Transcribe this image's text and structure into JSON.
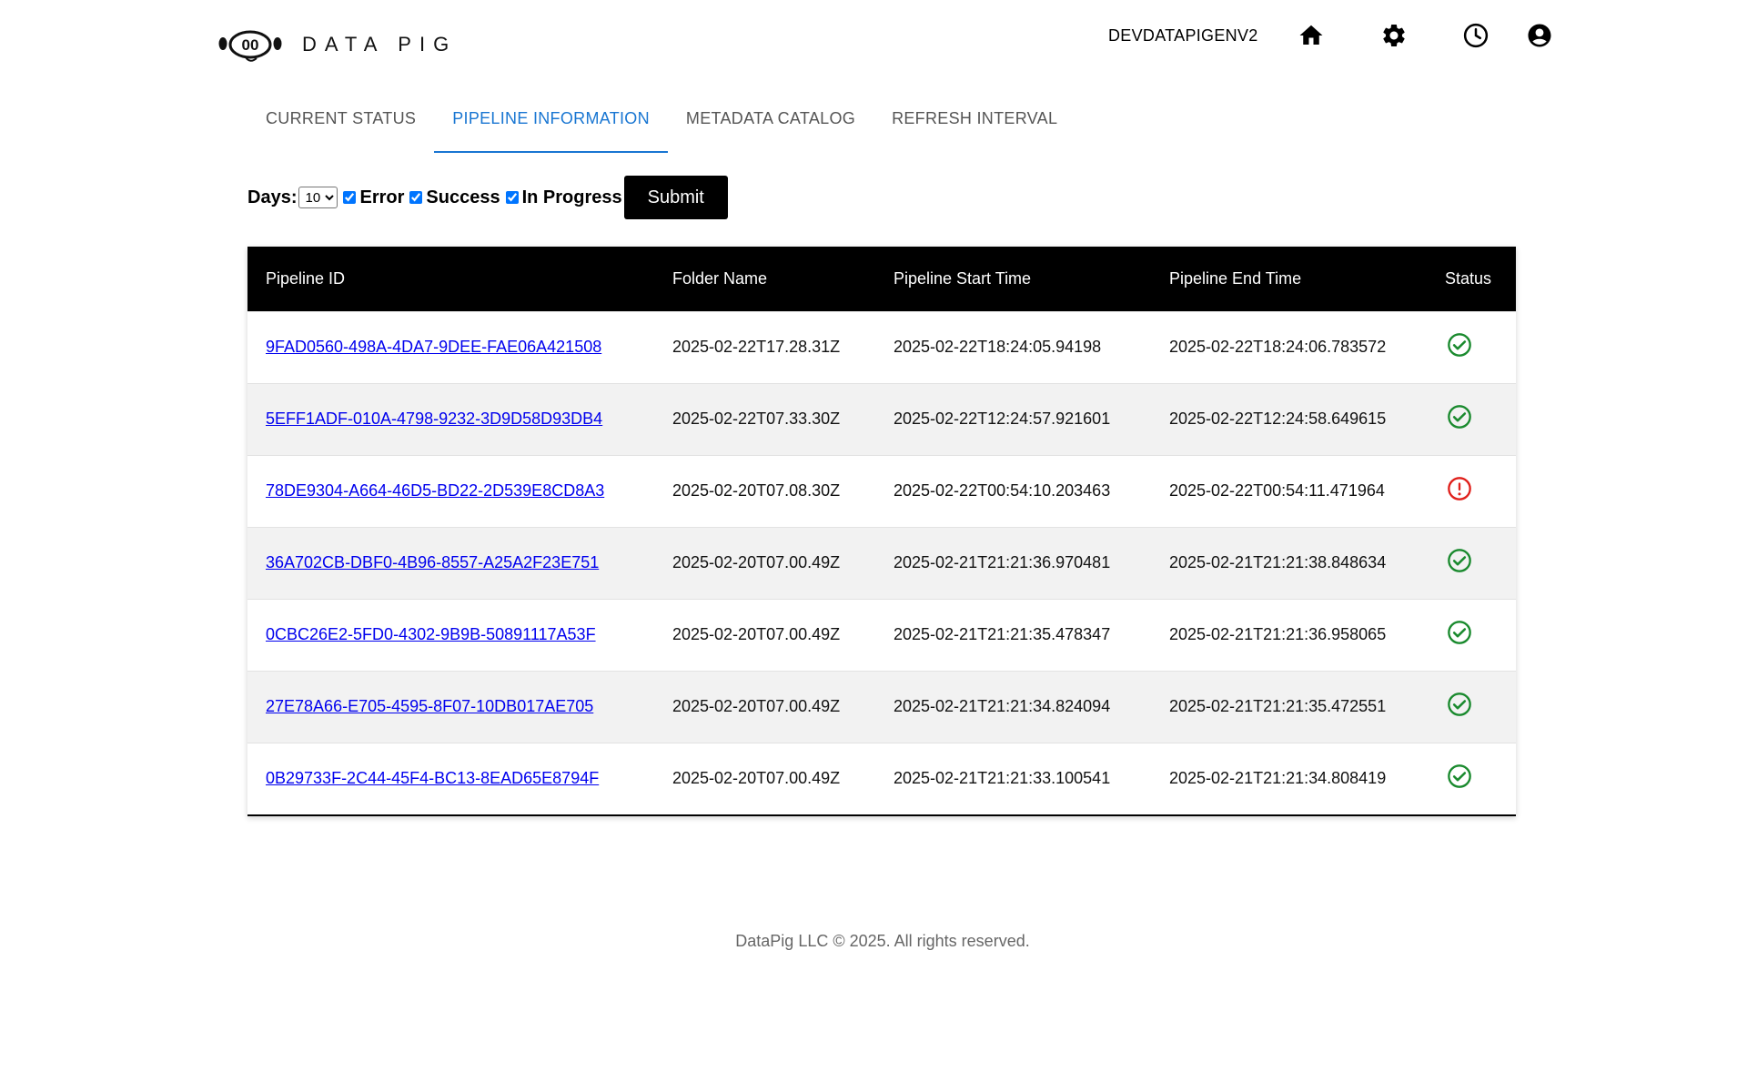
{
  "brand": {
    "name": "DATA PIG"
  },
  "header": {
    "environment": "DEVDATAPIGENV2",
    "icons": [
      "home-icon",
      "gear-icon",
      "clock-icon",
      "account-icon"
    ]
  },
  "tabs": [
    {
      "label": "CURRENT STATUS",
      "active": false
    },
    {
      "label": "PIPELINE INFORMATION",
      "active": true
    },
    {
      "label": "METADATA CATALOG",
      "active": false
    },
    {
      "label": "REFRESH INTERVAL",
      "active": false
    }
  ],
  "filters": {
    "days_label": "Days:",
    "days_value": "10",
    "error_label": "Error",
    "error_checked": true,
    "success_label": "Success",
    "success_checked": true,
    "in_progress_label": "In Progress",
    "in_progress_checked": true,
    "submit_label": "Submit"
  },
  "table": {
    "columns": [
      "Pipeline ID",
      "Folder Name",
      "Pipeline Start Time",
      "Pipeline End Time",
      "Status"
    ],
    "rows": [
      {
        "id": "9FAD0560-498A-4DA7-9DEE-FAE06A421508",
        "folder": "2025-02-22T17.28.31Z",
        "start": "2025-02-22T18:24:05.94198",
        "end": "2025-02-22T18:24:06.783572",
        "status": "success"
      },
      {
        "id": "5EFF1ADF-010A-4798-9232-3D9D58D93DB4",
        "folder": "2025-02-22T07.33.30Z",
        "start": "2025-02-22T12:24:57.921601",
        "end": "2025-02-22T12:24:58.649615",
        "status": "success"
      },
      {
        "id": "78DE9304-A664-46D5-BD22-2D539E8CD8A3",
        "folder": "2025-02-20T07.08.30Z",
        "start": "2025-02-22T00:54:10.203463",
        "end": "2025-02-22T00:54:11.471964",
        "status": "error"
      },
      {
        "id": "36A702CB-DBF0-4B96-8557-A25A2F23E751",
        "folder": "2025-02-20T07.00.49Z",
        "start": "2025-02-21T21:21:36.970481",
        "end": "2025-02-21T21:21:38.848634",
        "status": "success"
      },
      {
        "id": "0CBC26E2-5FD0-4302-9B9B-50891117A53F",
        "folder": "2025-02-20T07.00.49Z",
        "start": "2025-02-21T21:21:35.478347",
        "end": "2025-02-21T21:21:36.958065",
        "status": "success"
      },
      {
        "id": "27E78A66-E705-4595-8F07-10DB017AE705",
        "folder": "2025-02-20T07.00.49Z",
        "start": "2025-02-21T21:21:34.824094",
        "end": "2025-02-21T21:21:35.472551",
        "status": "success"
      },
      {
        "id": "0B29733F-2C44-45F4-BC13-8EAD65E8794F",
        "folder": "2025-02-20T07.00.49Z",
        "start": "2025-02-21T21:21:33.100541",
        "end": "2025-02-21T21:21:34.808419",
        "status": "success"
      }
    ]
  },
  "colors": {
    "success": "#1a8a2e",
    "error": "#e0201b",
    "accent": "#1976d2",
    "link": "#0000ee"
  },
  "footer": {
    "text": "DataPig LLC © 2025. All rights reserved."
  }
}
